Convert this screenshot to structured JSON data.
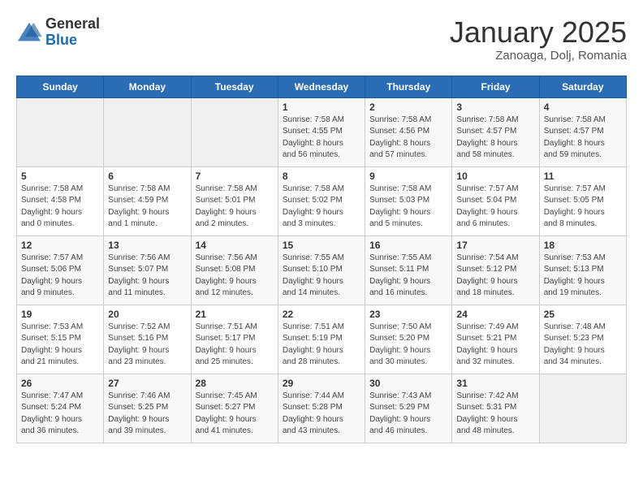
{
  "header": {
    "logo_line1": "General",
    "logo_line2": "Blue",
    "title": "January 2025",
    "subtitle": "Zanoaga, Dolj, Romania"
  },
  "weekdays": [
    "Sunday",
    "Monday",
    "Tuesday",
    "Wednesday",
    "Thursday",
    "Friday",
    "Saturday"
  ],
  "weeks": [
    [
      {
        "day": "",
        "content": ""
      },
      {
        "day": "",
        "content": ""
      },
      {
        "day": "",
        "content": ""
      },
      {
        "day": "1",
        "content": "Sunrise: 7:58 AM\nSunset: 4:55 PM\nDaylight: 8 hours\nand 56 minutes."
      },
      {
        "day": "2",
        "content": "Sunrise: 7:58 AM\nSunset: 4:56 PM\nDaylight: 8 hours\nand 57 minutes."
      },
      {
        "day": "3",
        "content": "Sunrise: 7:58 AM\nSunset: 4:57 PM\nDaylight: 8 hours\nand 58 minutes."
      },
      {
        "day": "4",
        "content": "Sunrise: 7:58 AM\nSunset: 4:57 PM\nDaylight: 8 hours\nand 59 minutes."
      }
    ],
    [
      {
        "day": "5",
        "content": "Sunrise: 7:58 AM\nSunset: 4:58 PM\nDaylight: 9 hours\nand 0 minutes."
      },
      {
        "day": "6",
        "content": "Sunrise: 7:58 AM\nSunset: 4:59 PM\nDaylight: 9 hours\nand 1 minute."
      },
      {
        "day": "7",
        "content": "Sunrise: 7:58 AM\nSunset: 5:01 PM\nDaylight: 9 hours\nand 2 minutes."
      },
      {
        "day": "8",
        "content": "Sunrise: 7:58 AM\nSunset: 5:02 PM\nDaylight: 9 hours\nand 3 minutes."
      },
      {
        "day": "9",
        "content": "Sunrise: 7:58 AM\nSunset: 5:03 PM\nDaylight: 9 hours\nand 5 minutes."
      },
      {
        "day": "10",
        "content": "Sunrise: 7:57 AM\nSunset: 5:04 PM\nDaylight: 9 hours\nand 6 minutes."
      },
      {
        "day": "11",
        "content": "Sunrise: 7:57 AM\nSunset: 5:05 PM\nDaylight: 9 hours\nand 8 minutes."
      }
    ],
    [
      {
        "day": "12",
        "content": "Sunrise: 7:57 AM\nSunset: 5:06 PM\nDaylight: 9 hours\nand 9 minutes."
      },
      {
        "day": "13",
        "content": "Sunrise: 7:56 AM\nSunset: 5:07 PM\nDaylight: 9 hours\nand 11 minutes."
      },
      {
        "day": "14",
        "content": "Sunrise: 7:56 AM\nSunset: 5:08 PM\nDaylight: 9 hours\nand 12 minutes."
      },
      {
        "day": "15",
        "content": "Sunrise: 7:55 AM\nSunset: 5:10 PM\nDaylight: 9 hours\nand 14 minutes."
      },
      {
        "day": "16",
        "content": "Sunrise: 7:55 AM\nSunset: 5:11 PM\nDaylight: 9 hours\nand 16 minutes."
      },
      {
        "day": "17",
        "content": "Sunrise: 7:54 AM\nSunset: 5:12 PM\nDaylight: 9 hours\nand 18 minutes."
      },
      {
        "day": "18",
        "content": "Sunrise: 7:53 AM\nSunset: 5:13 PM\nDaylight: 9 hours\nand 19 minutes."
      }
    ],
    [
      {
        "day": "19",
        "content": "Sunrise: 7:53 AM\nSunset: 5:15 PM\nDaylight: 9 hours\nand 21 minutes."
      },
      {
        "day": "20",
        "content": "Sunrise: 7:52 AM\nSunset: 5:16 PM\nDaylight: 9 hours\nand 23 minutes."
      },
      {
        "day": "21",
        "content": "Sunrise: 7:51 AM\nSunset: 5:17 PM\nDaylight: 9 hours\nand 25 minutes."
      },
      {
        "day": "22",
        "content": "Sunrise: 7:51 AM\nSunset: 5:19 PM\nDaylight: 9 hours\nand 28 minutes."
      },
      {
        "day": "23",
        "content": "Sunrise: 7:50 AM\nSunset: 5:20 PM\nDaylight: 9 hours\nand 30 minutes."
      },
      {
        "day": "24",
        "content": "Sunrise: 7:49 AM\nSunset: 5:21 PM\nDaylight: 9 hours\nand 32 minutes."
      },
      {
        "day": "25",
        "content": "Sunrise: 7:48 AM\nSunset: 5:23 PM\nDaylight: 9 hours\nand 34 minutes."
      }
    ],
    [
      {
        "day": "26",
        "content": "Sunrise: 7:47 AM\nSunset: 5:24 PM\nDaylight: 9 hours\nand 36 minutes."
      },
      {
        "day": "27",
        "content": "Sunrise: 7:46 AM\nSunset: 5:25 PM\nDaylight: 9 hours\nand 39 minutes."
      },
      {
        "day": "28",
        "content": "Sunrise: 7:45 AM\nSunset: 5:27 PM\nDaylight: 9 hours\nand 41 minutes."
      },
      {
        "day": "29",
        "content": "Sunrise: 7:44 AM\nSunset: 5:28 PM\nDaylight: 9 hours\nand 43 minutes."
      },
      {
        "day": "30",
        "content": "Sunrise: 7:43 AM\nSunset: 5:29 PM\nDaylight: 9 hours\nand 46 minutes."
      },
      {
        "day": "31",
        "content": "Sunrise: 7:42 AM\nSunset: 5:31 PM\nDaylight: 9 hours\nand 48 minutes."
      },
      {
        "day": "",
        "content": ""
      }
    ]
  ]
}
